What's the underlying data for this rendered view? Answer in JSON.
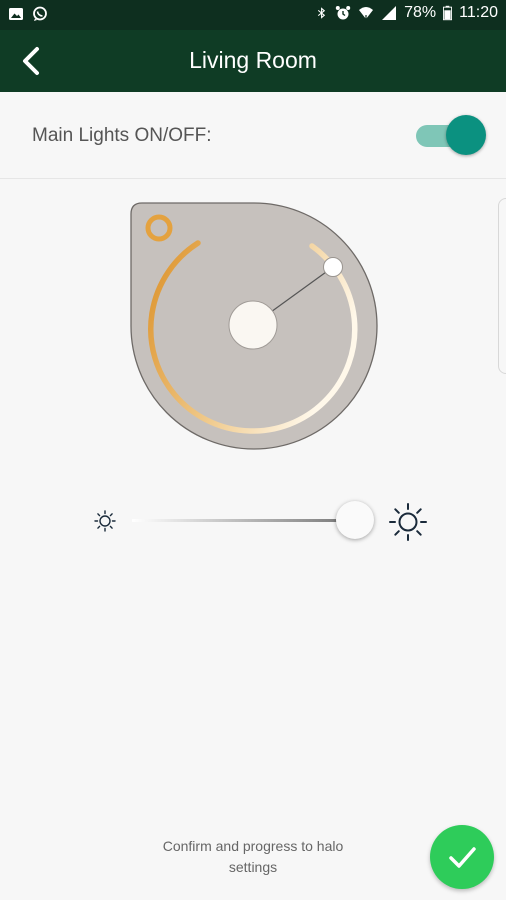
{
  "status_bar": {
    "battery": "78%",
    "time": "11:20",
    "icons": [
      "image-icon",
      "whatsapp-icon",
      "bluetooth-icon",
      "alarm-icon",
      "wifi-icon",
      "signal-icon",
      "battery-icon"
    ]
  },
  "header": {
    "title": "Living Room",
    "back_icon": "chevron-left-icon",
    "color": "#0f3c25"
  },
  "main_lights": {
    "label": "Main Lights ON/OFF:",
    "state": "on",
    "accent": "#0b9180"
  },
  "dial": {
    "body_color": "#c6c1bd",
    "arc_colors": [
      "#e29a2e",
      "#fdf3df"
    ]
  },
  "brightness": {
    "value_fraction": 0.95,
    "min_icon": "sun-small-icon",
    "max_icon": "sun-large-icon"
  },
  "footer": {
    "confirm_text": "Confirm and progress to halo settings",
    "confirm_icon": "check-icon",
    "confirm_color": "#2ecc5a"
  }
}
